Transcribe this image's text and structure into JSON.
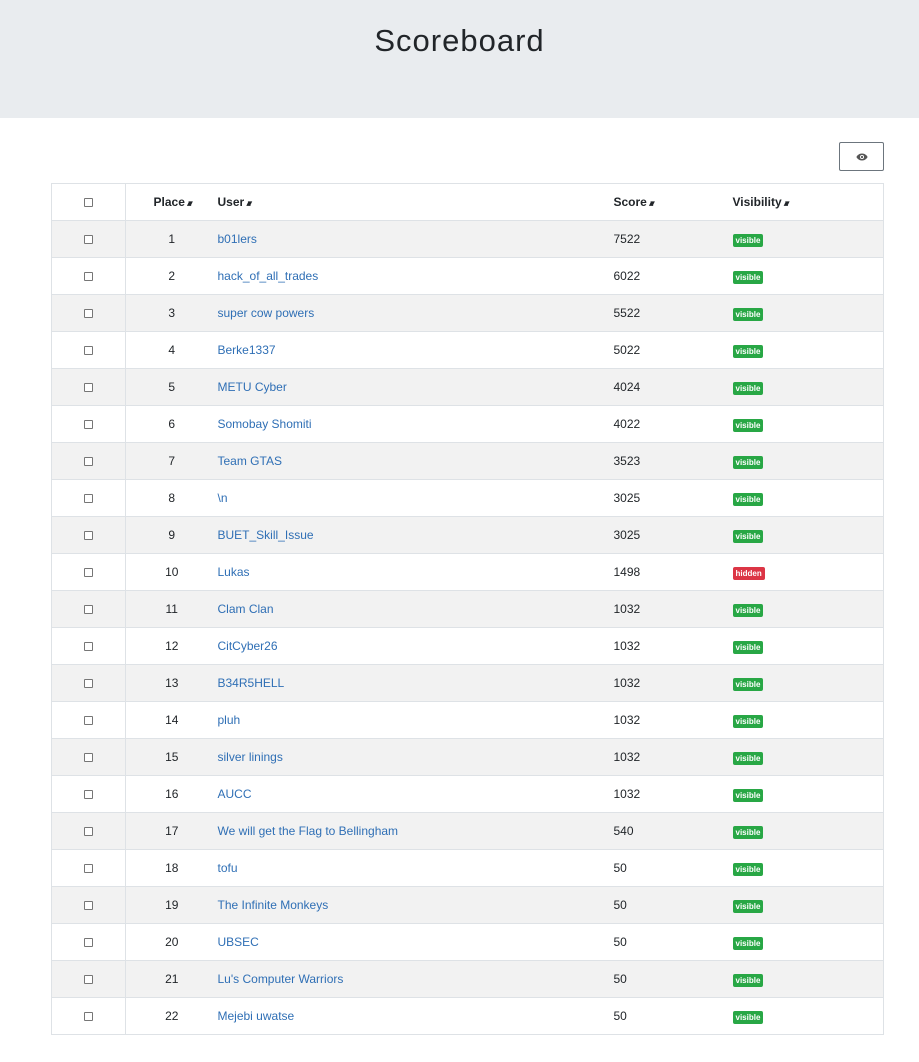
{
  "header": {
    "title": "Scoreboard"
  },
  "toolbar": {
    "toggle_visibility_icon": "eye-icon"
  },
  "table": {
    "columns": {
      "place": "Place",
      "user": "User",
      "score": "Score",
      "visibility": "Visibility"
    },
    "sort_icon": "sort-icon",
    "rows": [
      {
        "place": "1",
        "user": "b01lers",
        "score": "7522",
        "visibility": "visible"
      },
      {
        "place": "2",
        "user": "hack_of_all_trades",
        "score": "6022",
        "visibility": "visible"
      },
      {
        "place": "3",
        "user": "super cow powers",
        "score": "5522",
        "visibility": "visible"
      },
      {
        "place": "4",
        "user": "Berke1337",
        "score": "5022",
        "visibility": "visible"
      },
      {
        "place": "5",
        "user": "METU Cyber",
        "score": "4024",
        "visibility": "visible"
      },
      {
        "place": "6",
        "user": "Somobay Shomiti",
        "score": "4022",
        "visibility": "visible"
      },
      {
        "place": "7",
        "user": "Team GTAS",
        "score": "3523",
        "visibility": "visible"
      },
      {
        "place": "8",
        "user": "\\n",
        "score": "3025",
        "visibility": "visible"
      },
      {
        "place": "9",
        "user": "BUET_Skill_Issue",
        "score": "3025",
        "visibility": "visible"
      },
      {
        "place": "10",
        "user": "Lukas",
        "score": "1498",
        "visibility": "hidden"
      },
      {
        "place": "11",
        "user": "Clam Clan",
        "score": "1032",
        "visibility": "visible"
      },
      {
        "place": "12",
        "user": "CitCyber26",
        "score": "1032",
        "visibility": "visible"
      },
      {
        "place": "13",
        "user": "B34R5HELL",
        "score": "1032",
        "visibility": "visible"
      },
      {
        "place": "14",
        "user": "pluh",
        "score": "1032",
        "visibility": "visible"
      },
      {
        "place": "15",
        "user": "silver linings",
        "score": "1032",
        "visibility": "visible"
      },
      {
        "place": "16",
        "user": "AUCC",
        "score": "1032",
        "visibility": "visible"
      },
      {
        "place": "17",
        "user": "We will get the Flag to Bellingham",
        "score": "540",
        "visibility": "visible"
      },
      {
        "place": "18",
        "user": "tofu",
        "score": "50",
        "visibility": "visible"
      },
      {
        "place": "19",
        "user": "The Infinite Monkeys",
        "score": "50",
        "visibility": "visible"
      },
      {
        "place": "20",
        "user": "UBSEC",
        "score": "50",
        "visibility": "visible"
      },
      {
        "place": "21",
        "user": "Lu's Computer Warriors",
        "score": "50",
        "visibility": "visible"
      },
      {
        "place": "22",
        "user": "Mejebi uwatse",
        "score": "50",
        "visibility": "visible"
      }
    ]
  },
  "colors": {
    "visible": "#28a745",
    "hidden": "#dc3545",
    "link": "#2f6fb5",
    "header_bg": "#e9ecef"
  }
}
